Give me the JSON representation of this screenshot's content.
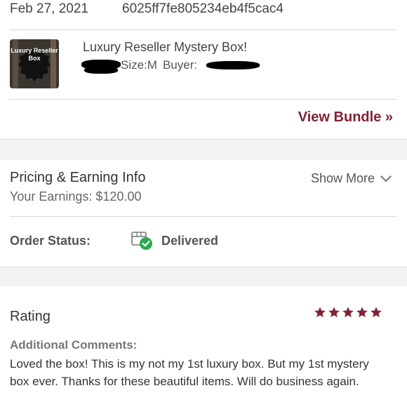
{
  "order": {
    "date": "Feb 27, 2021",
    "id": "6025ff7fe805234eb4f5cac4"
  },
  "item": {
    "title": "Luxury Reseller Mystery Box!",
    "size_text": "Size:M",
    "buyer_label": "Buyer:",
    "thumbnail_text": "Luxury Reseller Box",
    "view_bundle": "View Bundle »"
  },
  "pricing": {
    "title": "Pricing & Earning Info",
    "earnings": "Your Earnings: $120.00",
    "show_more": "Show More"
  },
  "status": {
    "label": "Order Status:",
    "value": "Delivered",
    "icon": "package-delivered-icon"
  },
  "rating": {
    "label": "Rating",
    "stars": 5,
    "max_stars": 5,
    "comments_label": "Additional Comments:",
    "comments": "Loved the box! This is my not my 1st luxury box. But my 1st mystery box ever. Thanks for these beautiful items. Will do business again."
  },
  "colors": {
    "accent": "#7f2433",
    "success": "#2eaa4f",
    "band": "#f4f3f2"
  }
}
